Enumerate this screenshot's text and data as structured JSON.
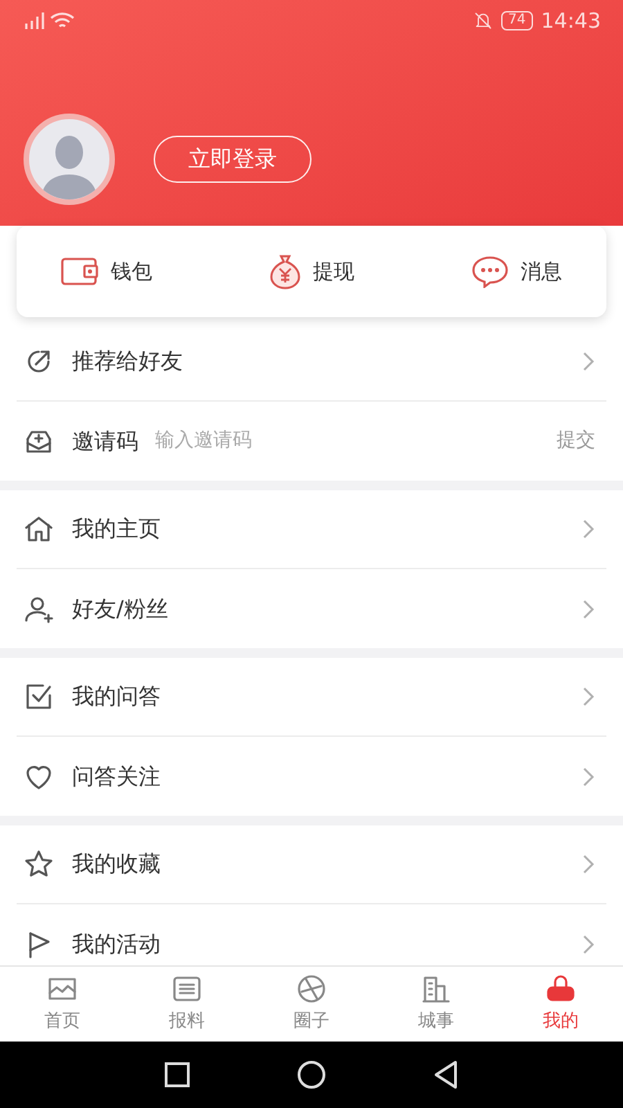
{
  "status_bar": {
    "battery": "74",
    "time": "14:43"
  },
  "profile": {
    "login_button": "立即登录"
  },
  "quick_actions": [
    {
      "label": "钱包"
    },
    {
      "label": "提现"
    },
    {
      "label": "消息"
    }
  ],
  "menu_groups": [
    {
      "items": [
        {
          "kind": "link",
          "label": "推荐给好友"
        },
        {
          "kind": "code",
          "label": "邀请码",
          "placeholder": "输入邀请码",
          "action": "提交"
        }
      ]
    },
    {
      "items": [
        {
          "kind": "link",
          "label": "我的主页"
        },
        {
          "kind": "link",
          "label": "好友/粉丝"
        }
      ]
    },
    {
      "items": [
        {
          "kind": "link",
          "label": "我的问答"
        },
        {
          "kind": "link",
          "label": "问答关注"
        }
      ]
    },
    {
      "items": [
        {
          "kind": "link",
          "label": "我的收藏"
        },
        {
          "kind": "link",
          "label": "我的活动"
        }
      ]
    }
  ],
  "tabs": [
    {
      "label": "首页",
      "selected": false
    },
    {
      "label": "报料",
      "selected": false
    },
    {
      "label": "圈子",
      "selected": false
    },
    {
      "label": "城事",
      "selected": false
    },
    {
      "label": "我的",
      "selected": true
    }
  ]
}
